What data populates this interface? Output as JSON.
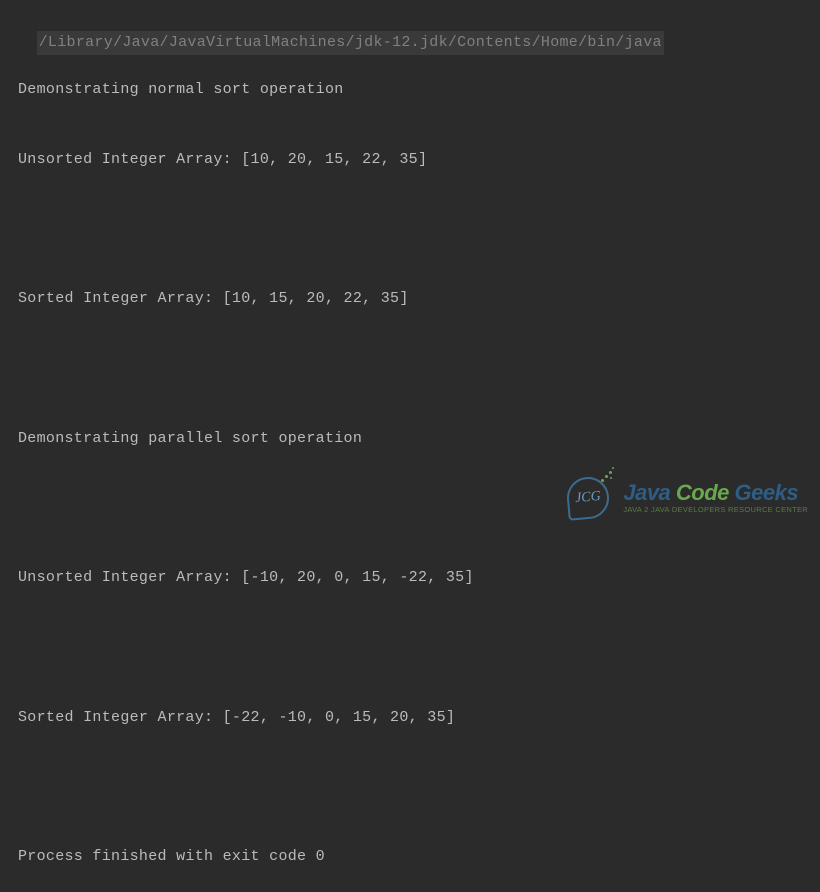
{
  "console": {
    "path": "/Library/Java/JavaVirtualMachines/jdk-12.jdk/Contents/Home/bin/java",
    "lines": [
      "Demonstrating normal sort operation",
      "Unsorted Integer Array: [10, 20, 15, 22, 35]",
      "",
      "Sorted Integer Array: [10, 15, 20, 22, 35]",
      "",
      "Demonstrating parallel sort operation",
      "",
      "Unsorted Integer Array: [-10, 20, 0, 15, -22, 35]",
      "",
      "Sorted Integer Array: [-22, -10, 0, 15, 20, 35]",
      "",
      "Process finished with exit code 0"
    ]
  },
  "logo": {
    "badge_text": "JCG",
    "main_word1": "Java",
    "main_word2": "Code",
    "main_word3": "Geeks",
    "tagline": "Java 2 Java Developers Resource Center"
  }
}
